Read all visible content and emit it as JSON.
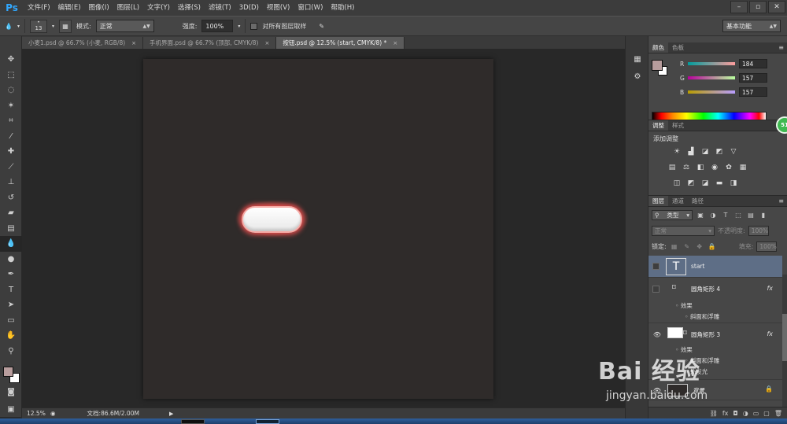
{
  "app": {
    "logo": "Ps"
  },
  "menu": [
    "文件(F)",
    "编辑(E)",
    "图像(I)",
    "图层(L)",
    "文字(Y)",
    "选择(S)",
    "滤镜(T)",
    "3D(D)",
    "视图(V)",
    "窗口(W)",
    "帮助(H)"
  ],
  "window_controls": [
    "–",
    "▫",
    "✕"
  ],
  "options": {
    "brush_size": "13",
    "mode_label": "模式:",
    "mode_value": "正常",
    "strength_label": "强度:",
    "strength_value": "100%",
    "sample_all_layers": "对所有图层取样",
    "workspace": "基本功能"
  },
  "tabs": [
    {
      "label": "小麦1.psd @ 66.7% (小麦, RGB/8)",
      "close": "×"
    },
    {
      "label": "手机界面.psd @ 66.7% (顶部, CMYK/8)",
      "close": "×"
    },
    {
      "label": "按钮.psd @ 12.5% (start, CMYK/8) *",
      "close": "×"
    }
  ],
  "status": {
    "zoom": "12.5%",
    "doc": "文档:86.6M/2.00M",
    "arrow": "▶"
  },
  "color_panel": {
    "tabs": [
      "颜色",
      "色板"
    ],
    "r_label": "R",
    "g_label": "G",
    "b_label": "B",
    "r": "184",
    "g": "157",
    "b": "157",
    "foreground": "#b89d9d"
  },
  "adjust_panel": {
    "tabs": [
      "调整",
      "样式"
    ],
    "title": "添加调整"
  },
  "badge": "51",
  "layers_panel": {
    "tabs": [
      "图层",
      "通道",
      "路径"
    ],
    "filter_kind": "类型",
    "blend_mode": "正常",
    "opacity_label": "不透明度:",
    "opacity_value": "100%",
    "lock_label": "锁定:",
    "fill_label": "填充:",
    "fill_value": "100%",
    "layers": [
      {
        "name": "start",
        "type_glyph": "T"
      },
      {
        "name": "圆角矩形 4",
        "fx": "fx",
        "effects": "效果",
        "effect1": "斜面和浮雕"
      },
      {
        "name": "圆角矩形 3",
        "fx": "fx",
        "effects": "效果",
        "effect1": "斜面和浮雕",
        "effect2": "外发光"
      },
      {
        "name": "背景"
      }
    ]
  },
  "watermark": {
    "brand": "Bai 经验",
    "url": "jingyan.baidu.com"
  }
}
